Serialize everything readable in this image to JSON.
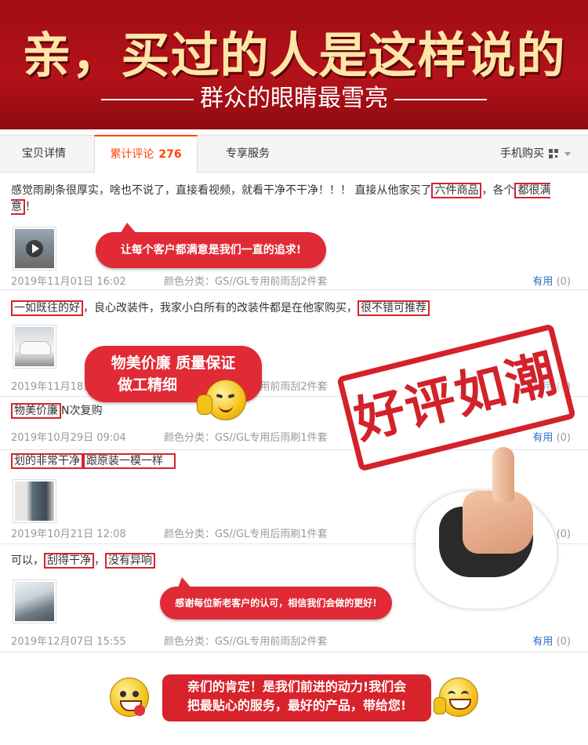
{
  "banner": {
    "title": "亲，买过的人是这样说的",
    "subtitle": "群众的眼睛最雪亮"
  },
  "tabs": {
    "detail": "宝贝详情",
    "reviews": "累计评论",
    "reviews_count": "276",
    "service": "专享服务",
    "mobile": "手机购买"
  },
  "reviews": [
    {
      "text_a": "感觉雨刷条很厚实，啥也不说了，直接看视频，就看干净不干净！！！ 直接从他家买了",
      "hl_1": "六件商品",
      "text_b": "，各个",
      "hl_2": "都很满意",
      "text_c": "！",
      "date": "2019年11月01日 16:02",
      "color": "颜色分类：GS//GL专用前雨刮2件套",
      "useful": "有用",
      "useful_count": "(0)"
    },
    {
      "hl_1": "一如既往的好",
      "text_a": "，良心改装件，我家小白所有的改装件都是在他家购买，",
      "hl_2": "很不错可推荐",
      "date": "2019年11月18日",
      "color": "颜色分类：GS//GL专用前雨刮2件套",
      "useful": "有用",
      "useful_count": "(0)"
    },
    {
      "hl_1": "物美价廉",
      "text_a": "N次复购",
      "date": "2019年10月29日 09:04",
      "color": "颜色分类：GS//GL专用后雨刷1件套",
      "useful": "有用",
      "useful_count": "(0)"
    },
    {
      "hl_1": "划的非常干净",
      "hl_2": "跟原装一模一样",
      "date": "2019年10月21日 12:08",
      "color": "颜色分类：GS//GL专用后雨刷1件套",
      "useful": "有用",
      "useful_count": "(0)"
    },
    {
      "text_a": "可以，",
      "hl_1": "刮得干净",
      "text_b": "，",
      "hl_2": "没有异响",
      "date": "2019年12月07日 15:55",
      "color": "颜色分类：GS//GL专用前雨刮2件套",
      "useful": "有用",
      "useful_count": "(0)"
    }
  ],
  "bubbles": {
    "b1": "让每个客户都满意是我们一直的追求!",
    "b2_line1": "物美价廉 质量保证",
    "b2_line2": "做工精细",
    "b3": "感谢每位新老客户的认可，相信我们会做的更好!"
  },
  "stamp": "好评如潮",
  "footer": {
    "line1": "亲们的肯定！是我们前进的动力!我们会",
    "line2": "把最贴心的服务，最好的产品，带给您!"
  },
  "colors": {
    "banner_red": "#a10d14",
    "accent_orange": "#ff4400",
    "highlight_red": "#d6232b",
    "link_blue": "#2c6fc1"
  }
}
